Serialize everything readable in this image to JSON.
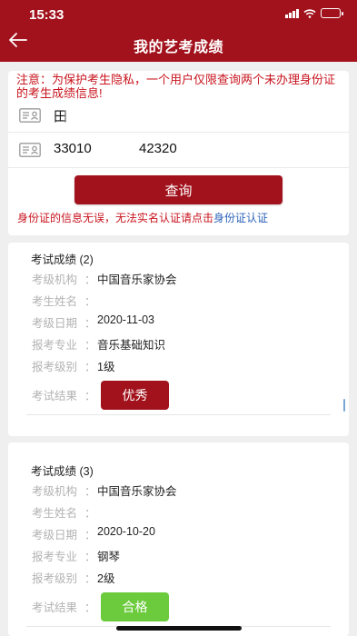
{
  "status": {
    "time": "15:33"
  },
  "header": {
    "title": "我的艺考成绩"
  },
  "notice": "注意：为保护考生隐私，一个用户仅限查询两个未办理身份证的考生成绩信息!",
  "form": {
    "name_value": "田",
    "id_prefix": "33010",
    "id_suffix": "42320"
  },
  "query_button": "查询",
  "verify_tip": {
    "text": "身份证的信息无误，无法实名认证请点击",
    "link": "身份证认证"
  },
  "labels": {
    "org": "考级机构",
    "name": "考生姓名",
    "date": "考级日期",
    "major": "报考专业",
    "level": "报考级别",
    "result": "考试结果",
    "colon": "："
  },
  "results": [
    {
      "title": "考试成绩 (2)",
      "org": "中国音乐家协会",
      "name": "",
      "date": "2020-11-03",
      "major": "音乐基础知识",
      "level": "1级",
      "result": "优秀",
      "result_color": "#a2121c"
    },
    {
      "title": "考试成绩 (3)",
      "org": "中国音乐家协会",
      "name": "",
      "date": "2020-10-20",
      "major": "钢琴",
      "level": "2级",
      "result": "合格",
      "result_color": "#6bcb3c"
    }
  ],
  "colors": {
    "brand": "#a2121c",
    "notice": "#c8141e",
    "link": "#2c62b8",
    "pass": "#6bcb3c"
  }
}
